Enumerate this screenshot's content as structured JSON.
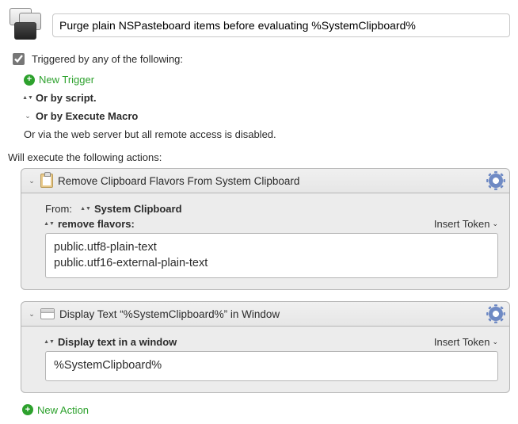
{
  "header": {
    "macro_name": "Purge plain NSPasteboard items before evaluating %SystemClipboard%"
  },
  "triggers": {
    "checked": true,
    "label": "Triggered by any of the following:",
    "new_trigger": "New Trigger",
    "by_script": "Or by script.",
    "by_execute_macro": "Or by Execute Macro",
    "web_server_note": "Or via the web server but all remote access is disabled."
  },
  "exec_label": "Will execute the following actions:",
  "actions": [
    {
      "title": "Remove Clipboard Flavors From System Clipboard",
      "from_label": "From:",
      "from_value": "System Clipboard",
      "remove_label": "remove flavors:",
      "insert_token": "Insert Token",
      "text": "public.utf8-plain-text\npublic.utf16-external-plain-text"
    },
    {
      "title": "Display Text “%SystemClipboard%” in Window",
      "mode_label": "Display text in a window",
      "insert_token": "Insert Token",
      "text": "%SystemClipboard%"
    }
  ],
  "new_action": "New Action"
}
